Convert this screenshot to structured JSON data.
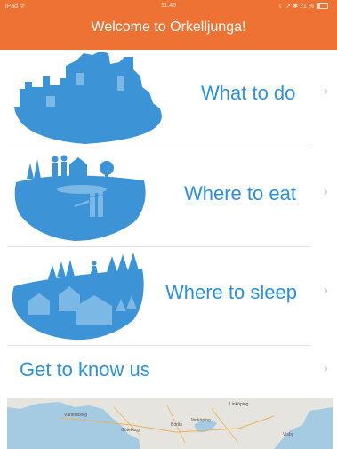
{
  "status_bar": {
    "carrier": "iPad ᯤ",
    "time": "11:46",
    "indicators": "☾ ➚ ✱ 21 %"
  },
  "header": {
    "title": "Welcome to Örkelljunga!"
  },
  "menu": [
    {
      "label": "What to do",
      "icon": "ruins-illustration"
    },
    {
      "label": "Where to eat",
      "icon": "picnic-hill-illustration"
    },
    {
      "label": "Where to sleep",
      "icon": "cabins-forest-illustration"
    },
    {
      "label": "Get to know us",
      "icon": ""
    }
  ],
  "chevron": "›",
  "map": {
    "towns": [
      "Vänersborg",
      "Göteborg",
      "Borås",
      "Jönköping",
      "Linköping",
      "Visby"
    ]
  },
  "colors": {
    "brand": "#ed7233",
    "accent": "#2e90d6",
    "illustration": "#3c93d5"
  }
}
